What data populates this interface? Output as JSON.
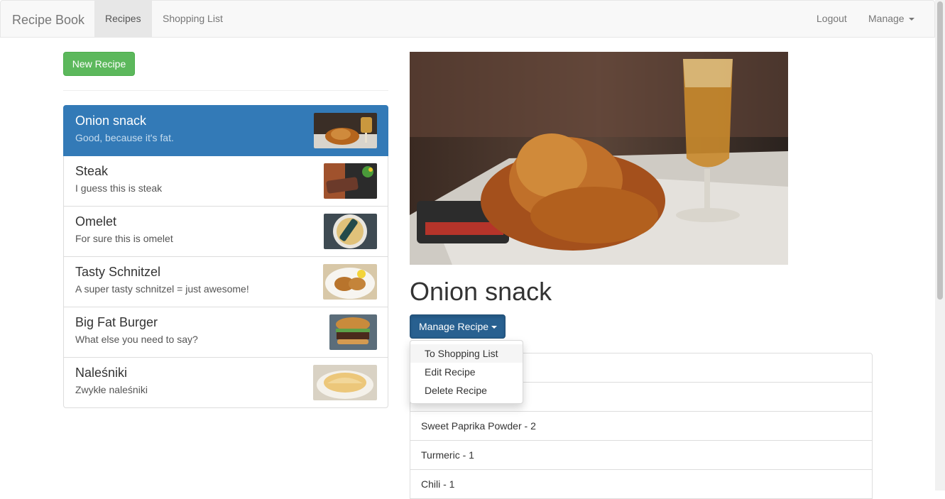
{
  "navbar": {
    "brand": "Recipe Book",
    "recipes": "Recipes",
    "shopping_list": "Shopping List",
    "logout": "Logout",
    "manage": "Manage"
  },
  "left": {
    "new_recipe": "New Recipe",
    "recipes": [
      {
        "name": "Onion snack",
        "description": "Good, because it's fat."
      },
      {
        "name": "Steak",
        "description": "I guess this is steak"
      },
      {
        "name": "Omelet",
        "description": "For sure this is omelet"
      },
      {
        "name": "Tasty Schnitzel",
        "description": "A super tasty schnitzel = just awesome!"
      },
      {
        "name": "Big Fat Burger",
        "description": "What else you need to say?"
      },
      {
        "name": "Naleśniki",
        "description": "Zwykłe naleśniki"
      }
    ]
  },
  "detail": {
    "title": "Onion snack",
    "manage_button": "Manage Recipe",
    "menu": [
      "To Shopping List",
      "Edit Recipe",
      "Delete Recipe"
    ],
    "ingredients": [
      "",
      "",
      "Sweet Paprika Powder - 2",
      "Turmeric - 1",
      "Chili - 1"
    ]
  },
  "colors": {
    "primary": "#337ab7",
    "success": "#5cb85c",
    "manage_active": "#286090"
  }
}
